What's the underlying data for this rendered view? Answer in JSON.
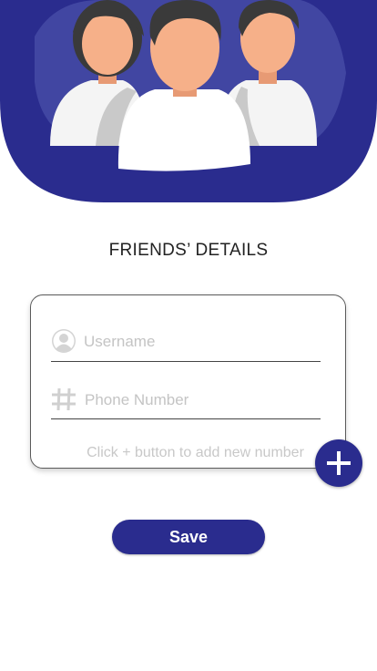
{
  "screen": {
    "title": "FRIENDS’ DETAILS"
  },
  "form": {
    "username_placeholder": "Username",
    "phone_placeholder": "Phone Number",
    "hint": "Click + button to add new number"
  },
  "actions": {
    "save_label": "Save",
    "add_icon": "plus-icon"
  },
  "icons": {
    "user": "user-avatar-icon",
    "phone": "hash-icon"
  },
  "colors": {
    "primary": "#2a2c8e",
    "hero_light": "#4a4fa8"
  }
}
